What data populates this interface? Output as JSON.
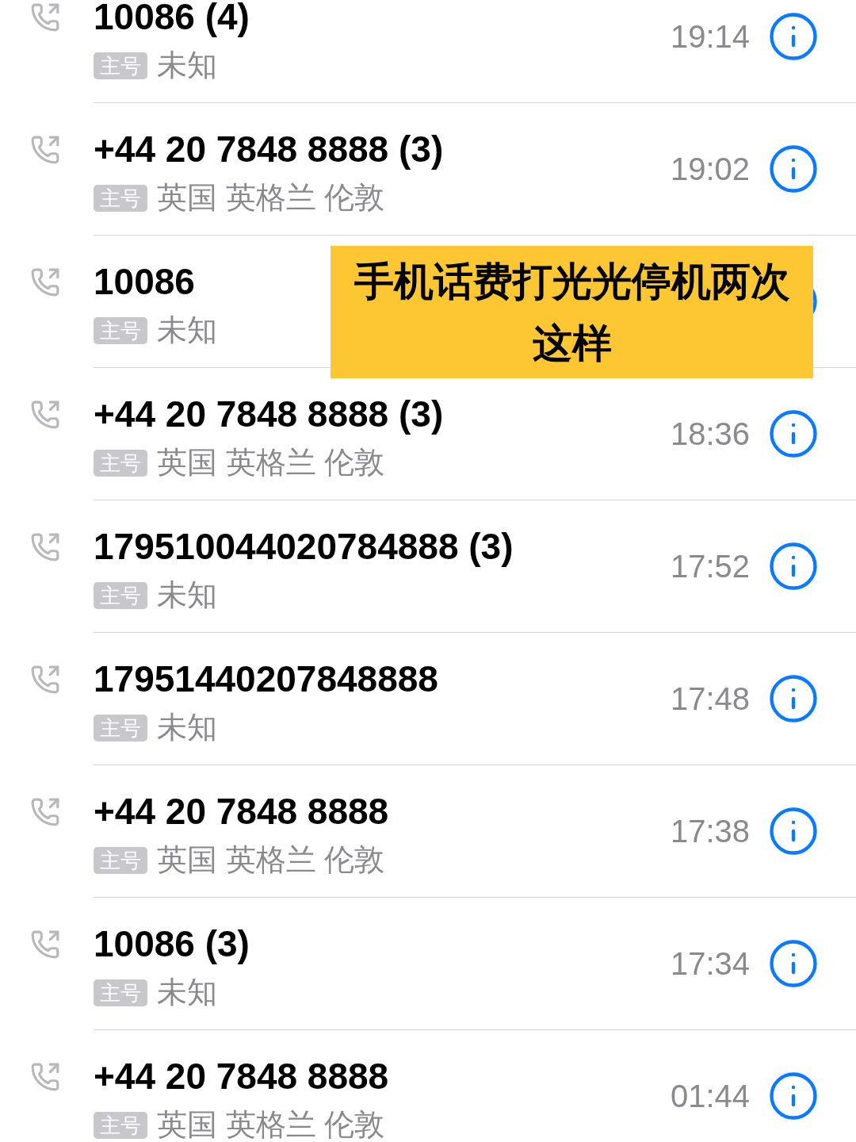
{
  "calls": [
    {
      "number": "10086 (4)",
      "tag": "主号",
      "location": "未知",
      "time": "19:14"
    },
    {
      "number": "+44 20 7848 8888 (3)",
      "tag": "主号",
      "location": "英国 英格兰 伦敦",
      "time": "19:02"
    },
    {
      "number": "10086",
      "tag": "主号",
      "location": "未知"
    },
    {
      "number": "+44 20 7848 8888 (3)",
      "tag": "主号",
      "location": "英国 英格兰 伦敦",
      "time": "18:36"
    },
    {
      "number": "179510044020784888 (3)",
      "tag": "主号",
      "location": "未知",
      "time": "17:52"
    },
    {
      "number": "17951440207848888",
      "tag": "主号",
      "location": "未知",
      "time": "17:48"
    },
    {
      "number": "+44 20 7848 8888",
      "tag": "主号",
      "location": "英国 英格兰 伦敦",
      "time": "17:38"
    },
    {
      "number": "10086 (3)",
      "tag": "主号",
      "location": "未知",
      "time": "17:34"
    },
    {
      "number": "+44 20 7848 8888",
      "tag": "主号",
      "location": "英国 英格兰 伦敦",
      "time": "01:44"
    }
  ],
  "caption": "手机话费打光光停机两次这样"
}
